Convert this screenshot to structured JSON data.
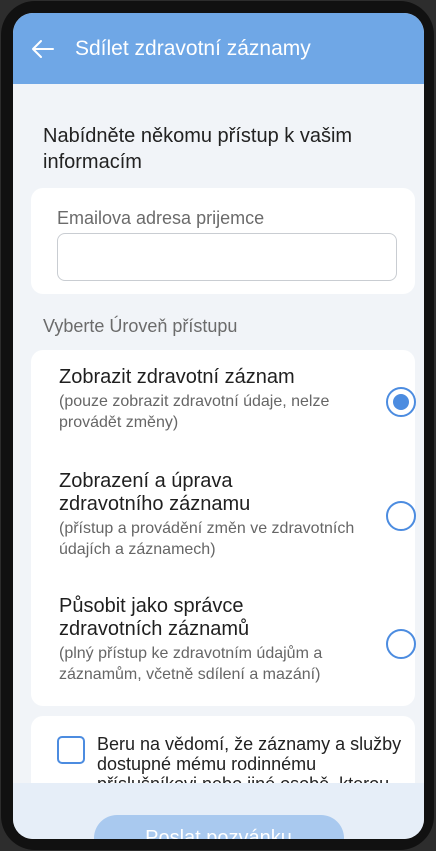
{
  "header": {
    "title": "Sdílet zdravotní záznamy"
  },
  "intro": {
    "text": "Nabídněte někomu přístup k vašim informacím"
  },
  "email": {
    "label": "Emailova adresa prijemce",
    "value": "",
    "placeholder": ""
  },
  "access": {
    "section_label": "Vyberte Úroveň přístupu",
    "options": [
      {
        "title": "Zobrazit zdravotní záznam",
        "description": "(pouze zobrazit zdravotní údaje, nelze provádět změny)",
        "selected": true
      },
      {
        "title": "Zobrazení a úprava zdravotního záznamu",
        "description": "(přístup a provádění změn ve zdravotních údajích a záznamech)",
        "selected": false
      },
      {
        "title": "Působit jako správce zdravotních záznamů",
        "description": "(plný přístup ke zdravotním údajům a záznamům, včetně sdílení a mazání)",
        "selected": false
      }
    ]
  },
  "consent": {
    "text": "Beru na vědomí, že záznamy a služby dostupné mému rodinnému příslušníkovi nebo jiné osobě, kterou",
    "checked": false
  },
  "footer": {
    "send_label": "Poslat pozvánku"
  },
  "colors": {
    "accent": "#4c8ce0",
    "header_bg": "#6fa7e6",
    "button_disabled": "#a9c9ef"
  },
  "icons": {
    "back": "arrow-left-icon"
  }
}
